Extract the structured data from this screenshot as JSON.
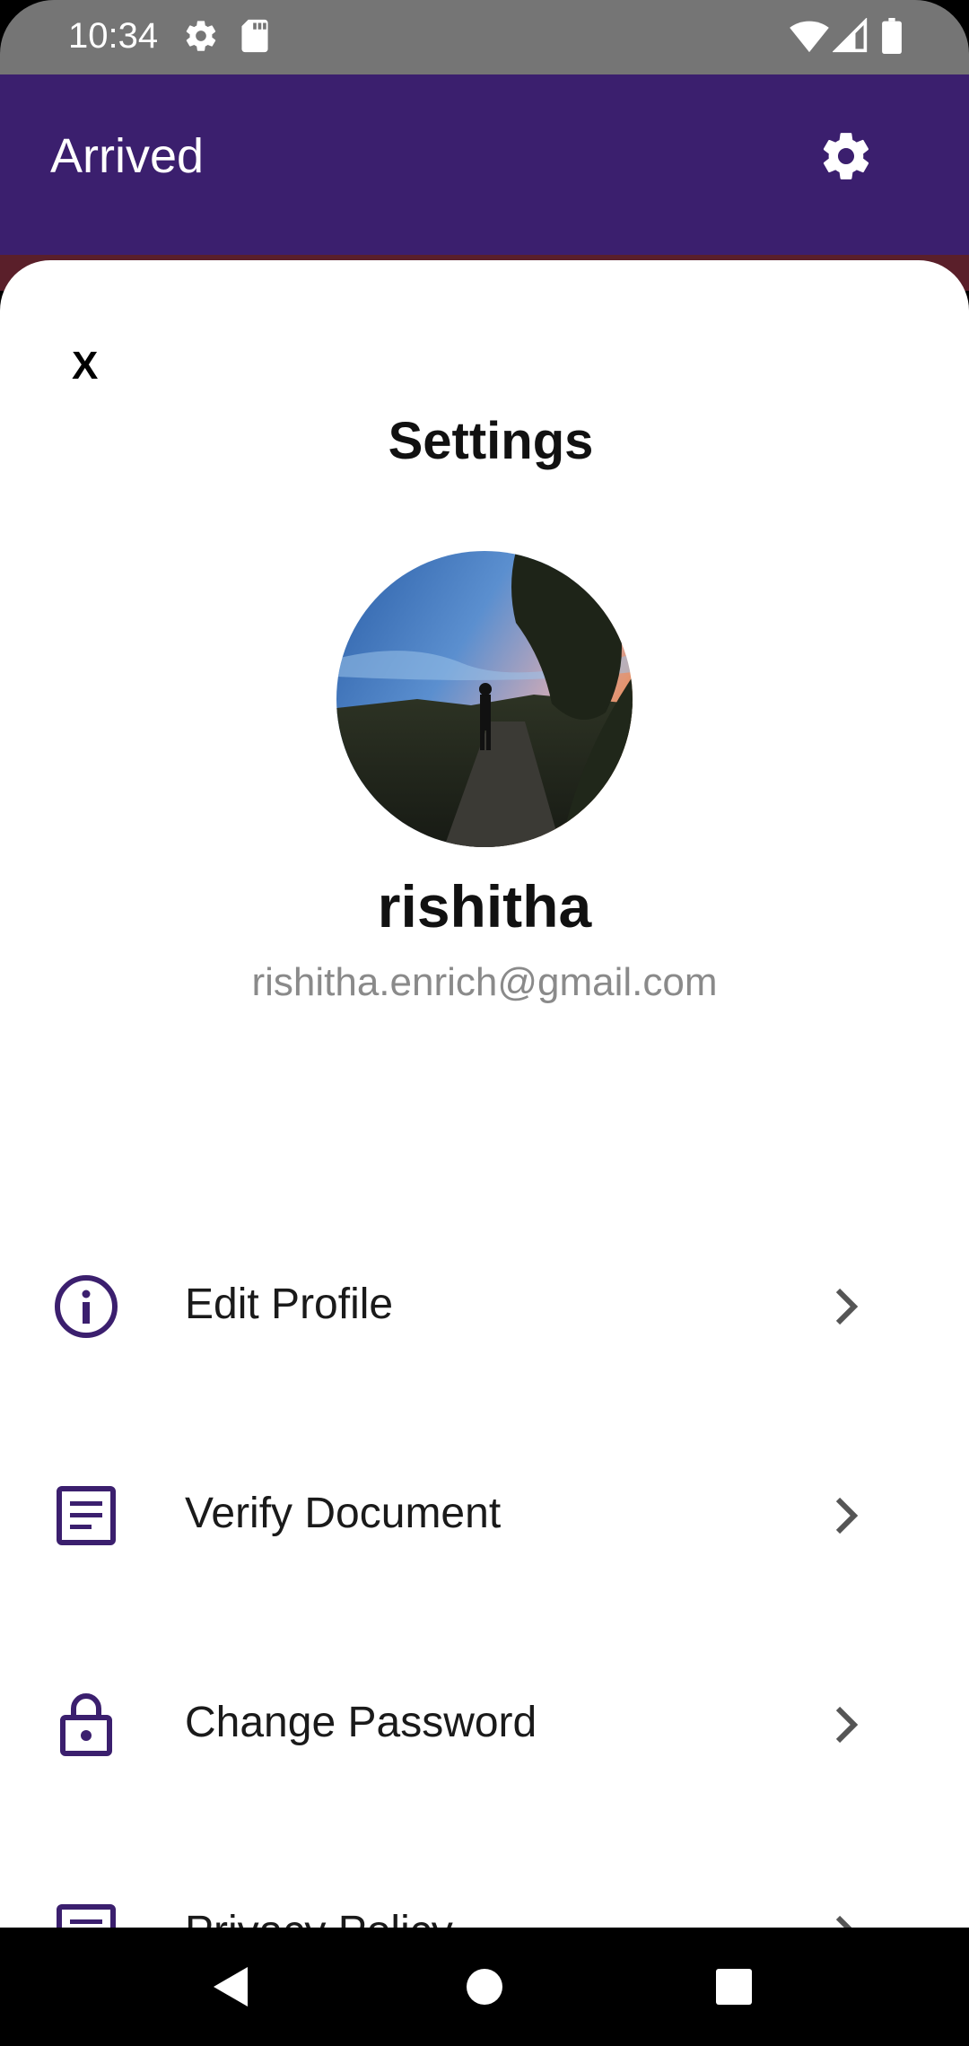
{
  "status_bar": {
    "time": "10:34",
    "icons": [
      "gear-icon",
      "sd-card-icon",
      "wifi-icon",
      "signal-icon",
      "battery-icon"
    ]
  },
  "app_bar": {
    "title": "Arrived",
    "action_icon": "gear-icon",
    "background_color": "#3b1f6e"
  },
  "sheet": {
    "close_label": "X",
    "title": "Settings",
    "profile": {
      "name": "rishitha",
      "email": "rishitha.enrich@gmail.com"
    },
    "menu": [
      {
        "label": "Edit Profile",
        "icon": "info-icon"
      },
      {
        "label": "Verify Document",
        "icon": "document-icon"
      },
      {
        "label": "Change Password",
        "icon": "lock-icon"
      },
      {
        "label": "Privacy Policy",
        "icon": "document-icon"
      }
    ]
  },
  "colors": {
    "accent": "#3b1f6e",
    "email_text": "#8a8a8a"
  },
  "nav_bar": {
    "buttons": [
      "back-icon",
      "home-icon",
      "recents-icon"
    ]
  }
}
